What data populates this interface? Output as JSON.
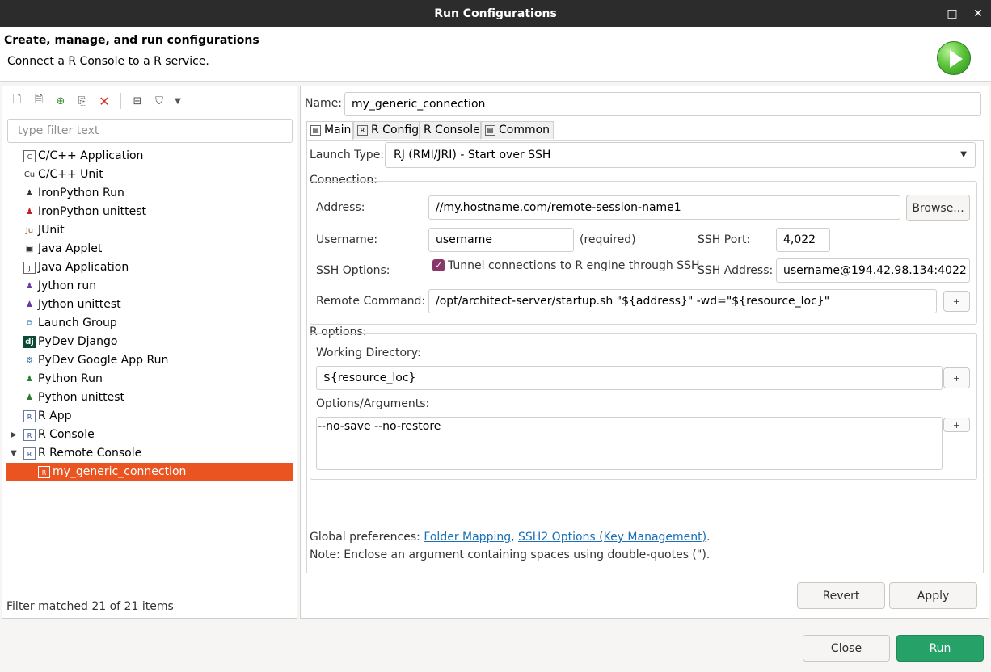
{
  "window": {
    "title": "Run Configurations",
    "maximize_icon": "□",
    "close_icon": "✕"
  },
  "header": {
    "title": "Create, manage, and run configurations",
    "description": "Connect a R Console to a R service."
  },
  "left_panel": {
    "filter_placeholder": "type filter text",
    "tree": [
      {
        "label": "C/C++ Application",
        "icon": "C"
      },
      {
        "label": "C/C++ Unit",
        "icon": "Cu"
      },
      {
        "label": "IronPython Run",
        "icon": "♟"
      },
      {
        "label": "IronPython unittest",
        "icon": "♟"
      },
      {
        "label": "JUnit",
        "icon": "Ju"
      },
      {
        "label": "Java Applet",
        "icon": "▣"
      },
      {
        "label": "Java Application",
        "icon": "J"
      },
      {
        "label": "Jython run",
        "icon": "♟"
      },
      {
        "label": "Jython unittest",
        "icon": "♟"
      },
      {
        "label": "Launch Group",
        "icon": "⧉"
      },
      {
        "label": "PyDev Django",
        "icon": "dj"
      },
      {
        "label": "PyDev Google App Run",
        "icon": "⚙"
      },
      {
        "label": "Python Run",
        "icon": "♟"
      },
      {
        "label": "Python unittest",
        "icon": "♟"
      },
      {
        "label": "R App",
        "icon": "R"
      },
      {
        "label": "R Console",
        "icon": "R",
        "twisty": "▶"
      },
      {
        "label": "R Remote Console",
        "icon": "R",
        "twisty": "▼"
      },
      {
        "label": "my_generic_connection",
        "icon": "R",
        "selected": true
      }
    ],
    "status": "Filter matched 21 of 21 items"
  },
  "form": {
    "name_label": "Name:",
    "name_value": "my_generic_connection",
    "tabs": [
      {
        "label": "Main",
        "icon": "▤"
      },
      {
        "label": "R Config",
        "icon": "R"
      },
      {
        "label": "R Console",
        "icon": ""
      },
      {
        "label": "Common",
        "icon": "▤"
      }
    ],
    "launch_type_label": "Launch Type:",
    "launch_type_value": "RJ (RMI/JRI) - Start over SSH",
    "connection_group": "Connection:",
    "address_label": "Address:",
    "address_value": "//my.hostname.com/remote-session-name1",
    "browse_button": "Browse...",
    "username_label": "Username:",
    "username_value": "username",
    "required_hint": "(required)",
    "ssh_port_label": "SSH Port:",
    "ssh_port_value": "4,022",
    "ssh_options_label": "SSH Options:",
    "tunnel_checkbox_label": "Tunnel connections to R engine through SSH",
    "ssh_address_label": "SSH Address:",
    "ssh_address_value": "username@194.42.98.134:4022",
    "remote_command_label": "Remote Command:",
    "remote_command_value": "/opt/architect-server/startup.sh \"${address}\" -wd=\"${resource_loc}\"",
    "r_options_group": "R options:",
    "working_dir_label": "Working Directory:",
    "working_dir_value": "${resource_loc}",
    "options_args_label": "Options/Arguments:",
    "options_args_value": "--no-save --no-restore",
    "variables_button": "+",
    "global_prefs_prefix": "Global preferences:",
    "link_folder_mapping": "Folder Mapping",
    "link_ssh2": "SSH2 Options (Key Management)",
    "note": "Note: Enclose an argument containing spaces using double-quotes (\")."
  },
  "buttons": {
    "revert": "Revert",
    "apply": "Apply",
    "close": "Close",
    "run": "Run"
  },
  "colors": {
    "selection": "#e95420",
    "run_button": "#26a269",
    "checkbox": "#873869",
    "link": "#1a6fb6"
  }
}
